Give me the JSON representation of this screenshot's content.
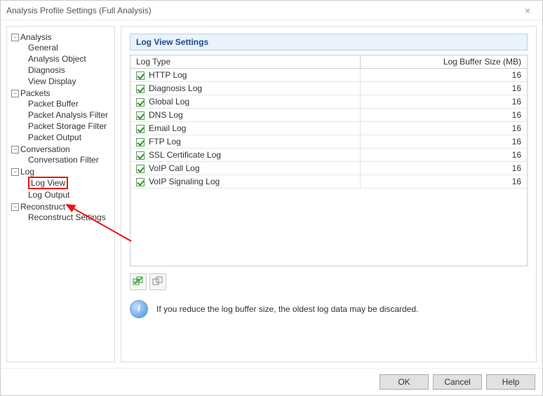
{
  "window": {
    "title": "Analysis Profile Settings (Full Analysis)"
  },
  "tree": {
    "analysis": {
      "label": "Analysis",
      "items": [
        "General",
        "Analysis Object",
        "Diagnosis",
        "View Display"
      ]
    },
    "packets": {
      "label": "Packets",
      "items": [
        "Packet Buffer",
        "Packet Analysis Filter",
        "Packet Storage Filter",
        "Packet Output"
      ]
    },
    "conversation": {
      "label": "Conversation",
      "items": [
        "Conversation Filter"
      ]
    },
    "log": {
      "label": "Log",
      "items": [
        "Log View",
        "Log Output"
      ],
      "selected": "Log View"
    },
    "reconstruct": {
      "label": "Reconstruct",
      "items": [
        "Reconstruct Settings"
      ]
    }
  },
  "panel": {
    "heading": "Log View Settings",
    "columns": {
      "type": "Log Type",
      "size": "Log Buffer Size (MB)"
    },
    "rows": [
      {
        "name": "HTTP Log",
        "size": 16,
        "checked": true
      },
      {
        "name": "Diagnosis Log",
        "size": 16,
        "checked": true
      },
      {
        "name": "Global Log",
        "size": 16,
        "checked": true
      },
      {
        "name": "DNS Log",
        "size": 16,
        "checked": true
      },
      {
        "name": "Email Log",
        "size": 16,
        "checked": true
      },
      {
        "name": "FTP Log",
        "size": 16,
        "checked": true
      },
      {
        "name": "SSL Certificate Log",
        "size": 16,
        "checked": true
      },
      {
        "name": "VoIP Call Log",
        "size": 16,
        "checked": true
      },
      {
        "name": "VoIP Signaling Log",
        "size": 16,
        "checked": true
      }
    ],
    "info_text": "If you reduce the log buffer size, the oldest log data may be discarded."
  },
  "buttons": {
    "ok": "OK",
    "cancel": "Cancel",
    "help": "Help"
  }
}
